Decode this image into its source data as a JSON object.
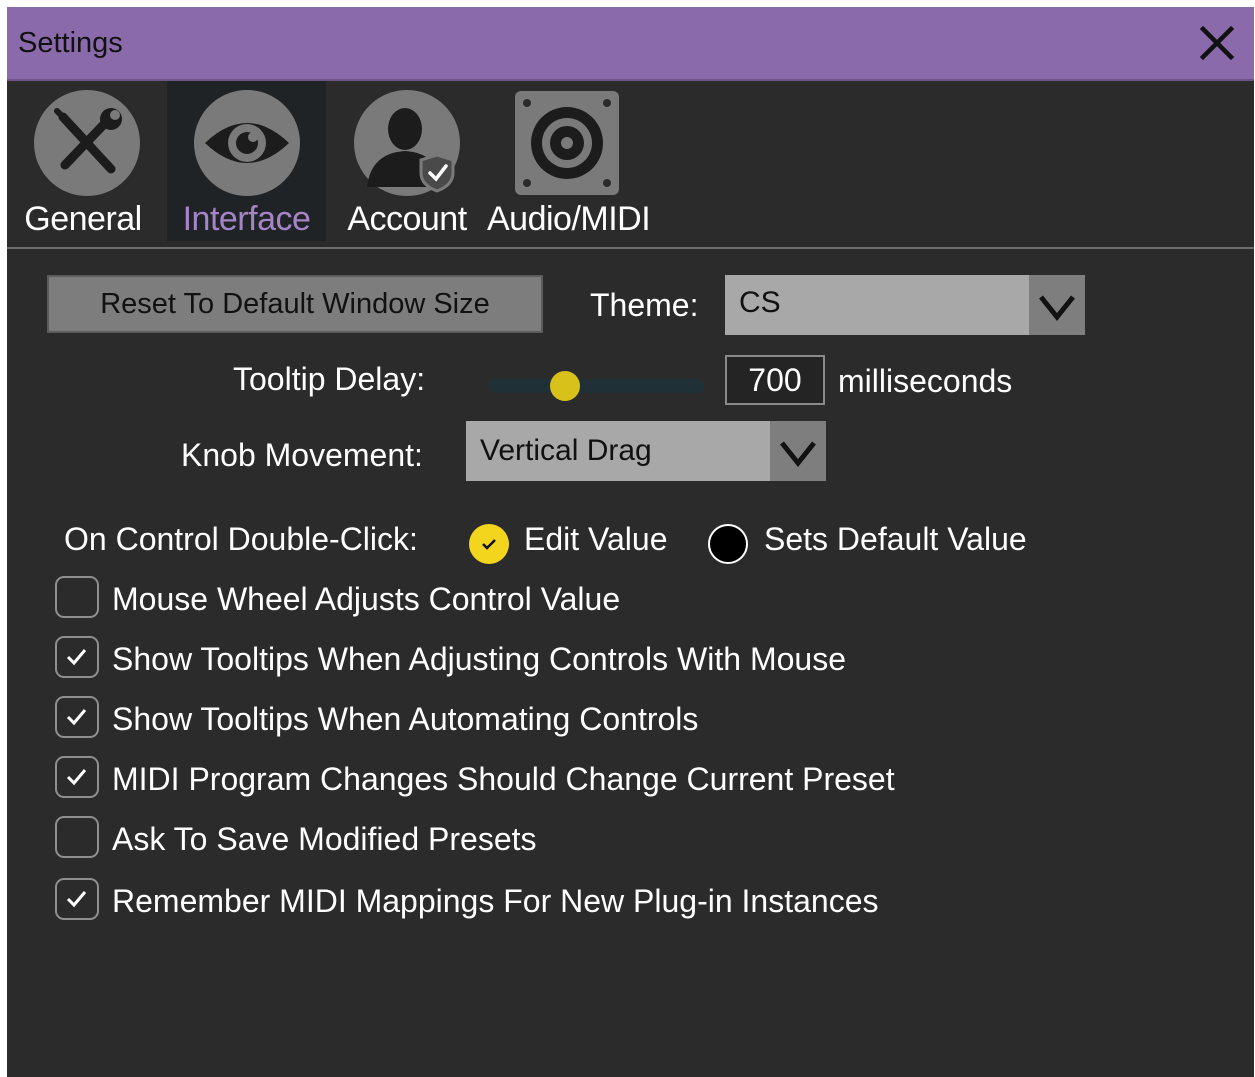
{
  "window": {
    "title": "Settings"
  },
  "tabs": [
    {
      "label": "General",
      "icon": "wrench-screwdriver-icon",
      "active": false
    },
    {
      "label": "Interface",
      "icon": "eye-icon",
      "active": true
    },
    {
      "label": "Account",
      "icon": "user-shield-icon",
      "active": false
    },
    {
      "label": "Audio/MIDI",
      "icon": "speaker-icon",
      "active": false
    }
  ],
  "interface": {
    "reset_button": "Reset To Default Window Size",
    "theme": {
      "label": "Theme:",
      "value": "CS"
    },
    "tooltip_delay": {
      "label": "Tooltip Delay:",
      "value": "700",
      "unit": "milliseconds",
      "slider_fraction": 0.36
    },
    "knob_movement": {
      "label": "Knob Movement:",
      "value": "Vertical Drag"
    },
    "double_click": {
      "label": "On Control Double-Click:",
      "options": [
        {
          "label": "Edit Value",
          "selected": true
        },
        {
          "label": "Sets Default Value",
          "selected": false
        }
      ]
    },
    "checkboxes": [
      {
        "label": "Mouse Wheel Adjusts Control Value",
        "checked": false
      },
      {
        "label": "Show Tooltips When Adjusting Controls With Mouse",
        "checked": true
      },
      {
        "label": "Show Tooltips When Automating Controls",
        "checked": true
      },
      {
        "label": "MIDI Program Changes Should Change Current Preset",
        "checked": true
      },
      {
        "label": "Ask To Save Modified Presets",
        "checked": false
      },
      {
        "label": "Remember MIDI Mappings For New Plug-in Instances",
        "checked": true
      }
    ]
  },
  "colors": {
    "titlebar": "#8a6aaa",
    "background": "#2b2b2b",
    "active_tab_text": "#a585c6",
    "accent": "#f2d51c"
  }
}
